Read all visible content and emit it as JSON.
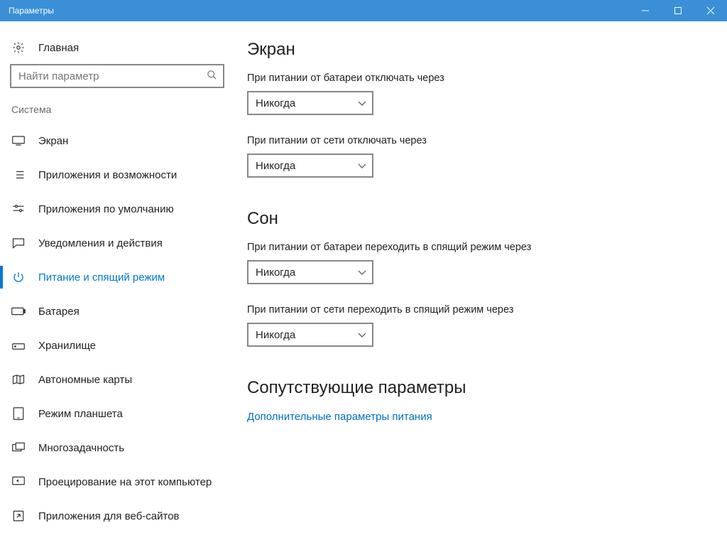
{
  "window": {
    "title": "Параметры"
  },
  "sidebar": {
    "home": "Главная",
    "search_placeholder": "Найти параметр",
    "category": "Система",
    "items": [
      {
        "label": "Экран"
      },
      {
        "label": "Приложения и возможности"
      },
      {
        "label": "Приложения по умолчанию"
      },
      {
        "label": "Уведомления и действия"
      },
      {
        "label": "Питание и спящий режим"
      },
      {
        "label": "Батарея"
      },
      {
        "label": "Хранилище"
      },
      {
        "label": "Автономные карты"
      },
      {
        "label": "Режим планшета"
      },
      {
        "label": "Многозадачность"
      },
      {
        "label": "Проецирование на этот компьютер"
      },
      {
        "label": "Приложения для веб-сайтов"
      }
    ]
  },
  "main": {
    "screen_header": "Экран",
    "screen_battery_label": "При питании от батареи отключать через",
    "screen_battery_value": "Никогда",
    "screen_ac_label": "При питании от сети отключать через",
    "screen_ac_value": "Никогда",
    "sleep_header": "Сон",
    "sleep_battery_label": "При питании от батареи переходить в спящий режим через",
    "sleep_battery_value": "Никогда",
    "sleep_ac_label": "При питании от сети переходить в спящий режим через",
    "sleep_ac_value": "Никогда",
    "related_header": "Сопутствующие параметры",
    "related_link": "Дополнительные параметры питания"
  }
}
